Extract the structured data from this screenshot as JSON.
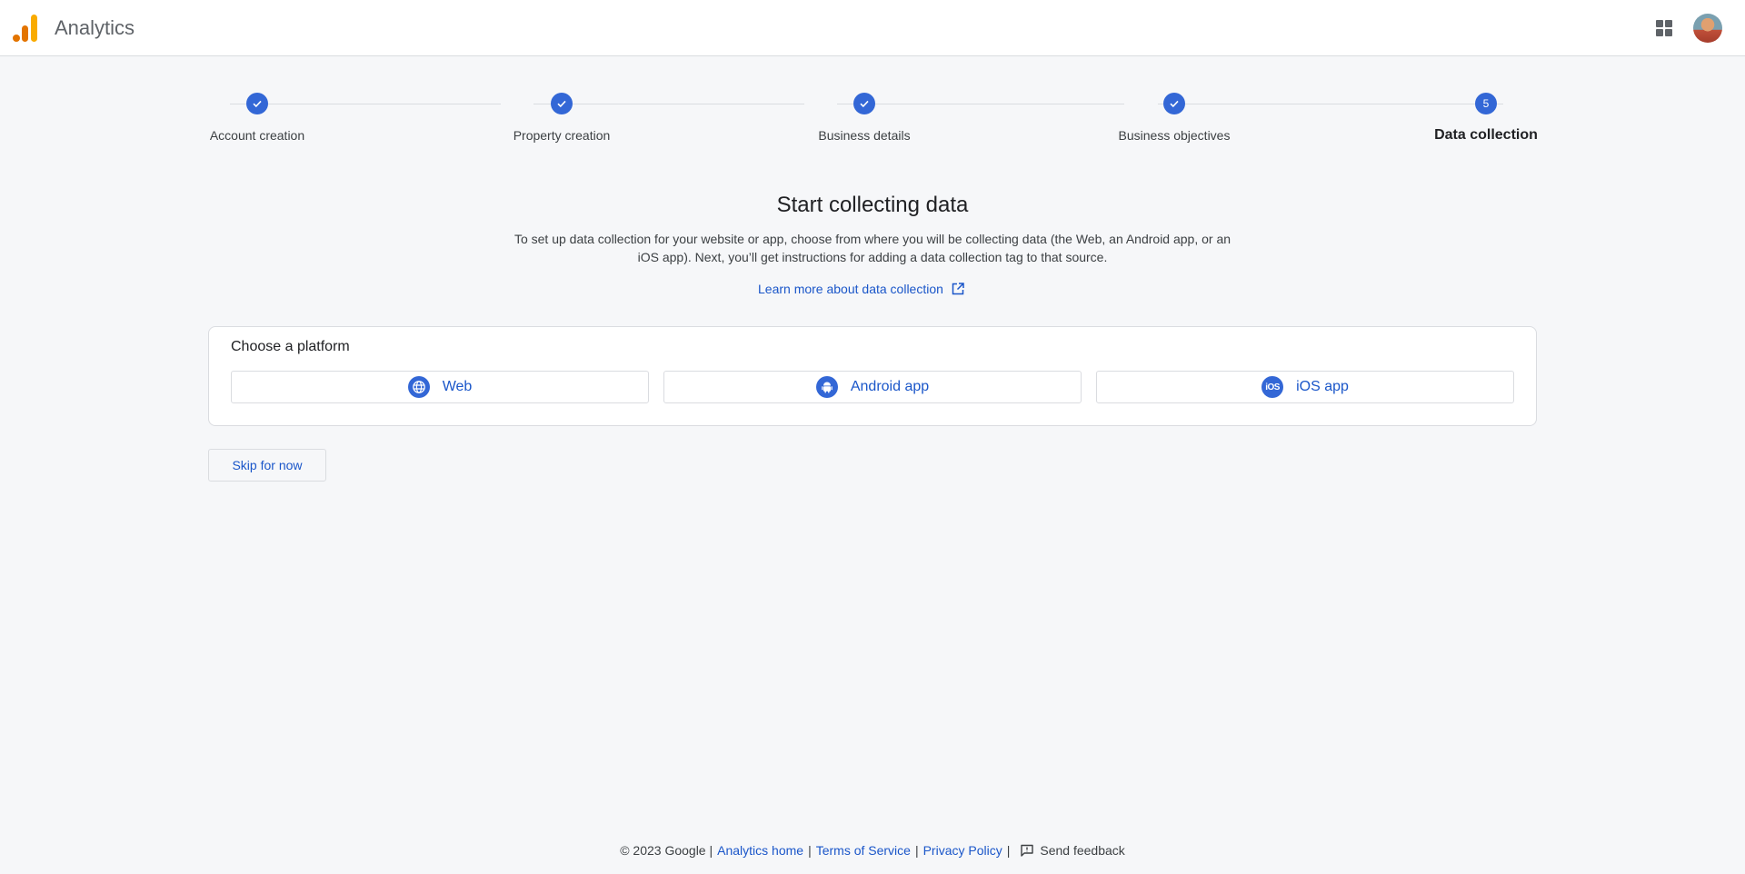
{
  "app": {
    "title": "Analytics"
  },
  "stepper": {
    "steps": [
      {
        "label": "Account creation",
        "state": "done"
      },
      {
        "label": "Property creation",
        "state": "done"
      },
      {
        "label": "Business details",
        "state": "done"
      },
      {
        "label": "Business objectives",
        "state": "done"
      },
      {
        "label": "Data collection",
        "state": "active",
        "number": "5"
      }
    ]
  },
  "intro": {
    "title": "Start collecting data",
    "description": "To set up data collection for your website or app, choose from where you will be collecting data (the Web, an Android app, or an iOS app). Next, you’ll get instructions for adding a data collection tag to that source.",
    "learn_more": "Learn more about data collection"
  },
  "platform": {
    "heading": "Choose a platform",
    "options": [
      {
        "label": "Web",
        "icon": "globe-icon"
      },
      {
        "label": "Android app",
        "icon": "android-icon"
      },
      {
        "label": "iOS app",
        "icon": "ios-icon",
        "icon_text": "iOS"
      }
    ]
  },
  "skip_label": "Skip for now",
  "footer": {
    "copyright": "© 2023 Google |",
    "analytics_home": "Analytics home",
    "sep1": "|",
    "terms": "Terms of Service",
    "sep2": "|",
    "privacy": "Privacy Policy",
    "sep3": "|",
    "feedback": "Send feedback"
  },
  "colors": {
    "accent": "#3367d6",
    "link": "#1a56c9",
    "background": "#f6f7f9"
  }
}
